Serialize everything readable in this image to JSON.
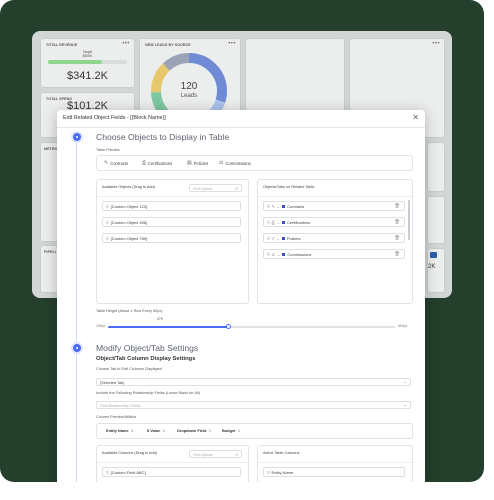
{
  "dashboard": {
    "total_revenue": {
      "title": "TOTAL REVENUE",
      "target_label": "Target",
      "target_value": "$500K",
      "value": "$341.2K"
    },
    "leads_by_source": {
      "title": "NEW LEADS BY SOURCE",
      "value": "120",
      "unit": "Leads"
    },
    "total_spend": {
      "title": "TOTAL SPEND",
      "value": "$101.2K"
    },
    "partial_labels": {
      "left_a": "METRIC",
      "left_b": "PIPELI",
      "right_value": "2K"
    },
    "donut_colors": [
      "#6f8bd6",
      "#a9c3ee",
      "#7fc7a3",
      "#e8c86d",
      "#9aa4b6"
    ]
  },
  "modal": {
    "title": "Edit Related Object Fields - [{Block Name}]",
    "close": "✕",
    "step1": {
      "heading": "Choose Objects to Display in Table",
      "preview_label": "Table Preview",
      "tabs": [
        {
          "icon": "✎",
          "label": "Contracts"
        },
        {
          "icon": "⎙",
          "label": "Certifications"
        },
        {
          "icon": "▤",
          "label": "Policies"
        },
        {
          "icon": "⚖",
          "label": "Commissions"
        }
      ],
      "available": {
        "title": "Available Objects (Drag to Add)",
        "search_placeholder": "Find Options...",
        "items": [
          "{Custom Object 123}",
          "{Custom Object 456}",
          "{Custom Object 789}"
        ]
      },
      "selected": {
        "title": "Objects/Tabs on Related Table",
        "items": [
          {
            "type_icon": "✎",
            "label": "Contracts"
          },
          {
            "type_icon": "⎙",
            "label": "Certifications"
          },
          {
            "type_icon": "▽",
            "label": "Policies"
          },
          {
            "type_icon": "⚖",
            "label": "Commissions"
          }
        ]
      },
      "height": {
        "label": "Table Height (About 1 Row Every 50px)",
        "value": "375",
        "min": "150px",
        "max": "600px",
        "fill_fraction": 0.42
      }
    },
    "step2": {
      "heading": "Modify Object/Tab Settings",
      "subheading": "Object/Tab Column Display Settings",
      "choose_tab_label": "Choose Tab to Edit Columns Displayed",
      "choose_tab_value": "{Selected Tab}",
      "fields_label": "Include the Following Relationship Fields (Leave Blank for All)",
      "fields_placeholder": "Find Relationship Fields",
      "preview_label": "Column Preview/Widths",
      "columns": [
        "Entity Name",
        "$ Value",
        "Dropdown Field",
        "Budget"
      ],
      "available": {
        "title": "Available Columns (Drag to Add)",
        "search_placeholder": "Find Options...",
        "items": [
          "{Custom Field ABC}"
        ]
      },
      "active": {
        "title": "Active Table Columns",
        "items": [
          "Entity Name"
        ]
      }
    }
  }
}
